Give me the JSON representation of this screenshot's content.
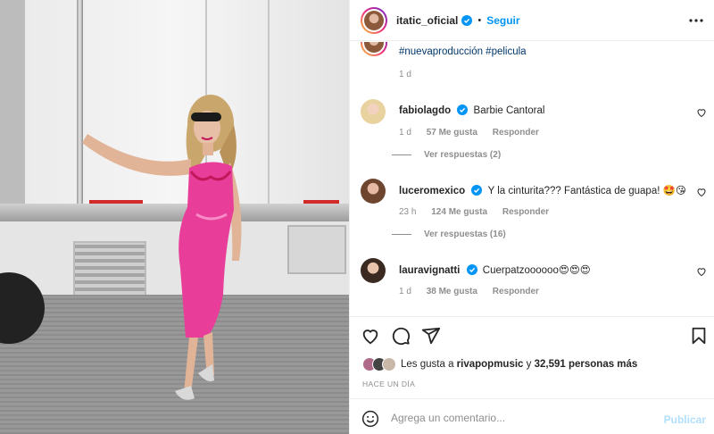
{
  "header": {
    "username": "itatic_oficial",
    "separator": "•",
    "follow_label": "Seguir"
  },
  "caption": {
    "hashtags": "#nuevaproducción #pelicula",
    "time": "1 d"
  },
  "comments": [
    {
      "username": "fabiolagdo",
      "text": "Barbie Cantoral",
      "time": "1 d",
      "likes": "57 Me gusta",
      "reply": "Responder",
      "view_replies": "Ver respuestas (2)",
      "verified": true
    },
    {
      "username": "luceromexico",
      "text": "Y la cinturita??? Fantástica de guapa! 🤩😘",
      "time": "23 h",
      "likes": "124 Me gusta",
      "reply": "Responder",
      "view_replies": "Ver respuestas (16)",
      "verified": true
    },
    {
      "username": "lauravignatti",
      "text": "Cuerpatzoooooo😍😍😍",
      "time": "1 d",
      "likes": "38 Me gusta",
      "reply": "Responder",
      "verified": true
    }
  ],
  "likes": {
    "prefix": "Les gusta a",
    "user": "rivapopmusic",
    "middle": "y",
    "count": "32,591 personas más"
  },
  "posted_ago": "HACE UN DÍA",
  "compose": {
    "placeholder": "Agrega un comentario...",
    "publish_label": "Publicar"
  },
  "colors": {
    "accent": "#0095f6",
    "link": "#00376b",
    "muted": "#8e8e8e",
    "publish_disabled": "#b2dffc"
  }
}
